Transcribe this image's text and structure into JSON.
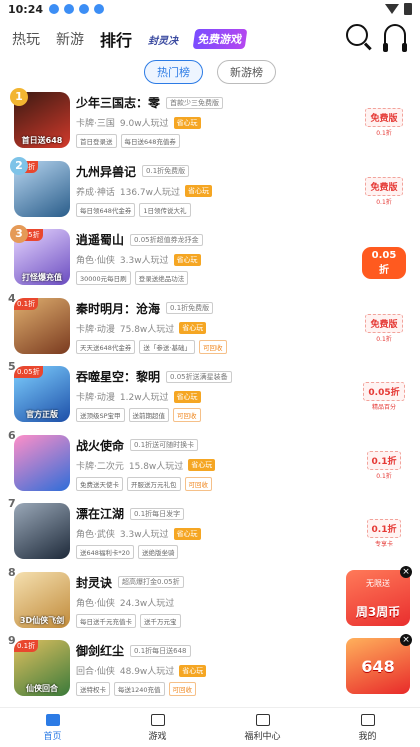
{
  "status": {
    "time": "10:24"
  },
  "header": {
    "tabs": [
      {
        "label": "热玩",
        "active": false
      },
      {
        "label": "新游",
        "active": false
      },
      {
        "label": "排行",
        "active": true
      }
    ],
    "logo1": "封灵决",
    "logo2": "免费游戏"
  },
  "subtabs": [
    {
      "label": "热门榜",
      "active": true
    },
    {
      "label": "新游榜",
      "active": false
    }
  ],
  "games": [
    {
      "rank": "1",
      "name": "少年三国志：零",
      "promo": "首款少三免费版",
      "meta1": "卡牌·三国",
      "players": "9.0w人玩过",
      "hot": "省心玩",
      "chips": [
        "首日登录送",
        "每日送648充值券"
      ],
      "icon_tag": "",
      "icon_caption": "首日送648",
      "badge": "免费版",
      "badge_sub": "0.1折",
      "badge_style": "outline",
      "colors": [
        "#d33a2c",
        "#3a1a12"
      ]
    },
    {
      "rank": "2",
      "name": "九州异兽记",
      "promo": "0.1折免费版",
      "meta1": "养成·神话",
      "players": "136.7w人玩过",
      "hot": "省心玩",
      "chips": [
        "每日领648代金券",
        "1日领传说大礼"
      ],
      "icon_tag": "0.1折",
      "icon_caption": "",
      "badge": "免费版",
      "badge_sub": "0.1折",
      "badge_style": "outline",
      "colors": [
        "#2a5d8a",
        "#b8d6f0"
      ]
    },
    {
      "rank": "3",
      "name": "逍遥蜀山",
      "promo": "0.05折超值券龙抒金",
      "meta1": "角色·仙侠",
      "players": "3.3w人玩过",
      "hot": "省心玩",
      "chips": [
        "30000元每日刷",
        "登录送绝品功法"
      ],
      "icon_tag": "0.05折",
      "icon_caption": "打怪爆充值",
      "badge": "0.05折",
      "badge_sub": "",
      "badge_style": "solid",
      "colors": [
        "#6a4cc0",
        "#e7d6ff"
      ]
    },
    {
      "rank": "4",
      "name": "秦时明月：沧海",
      "promo": "0.1折免费版",
      "meta1": "卡牌·动漫",
      "players": "75.8w人玩过",
      "hot": "省心玩",
      "chips": [
        "天天送648代金券",
        "送「参送·基础」",
        "可回收"
      ],
      "icon_tag": "0.1折",
      "icon_caption": "",
      "badge": "免费版",
      "badge_sub": "0.1折",
      "badge_style": "outline",
      "colors": [
        "#7a3a1f",
        "#e0b070"
      ]
    },
    {
      "rank": "5",
      "name": "吞噬星空：黎明",
      "promo": "0.05折送满星装备",
      "meta1": "卡牌·动漫",
      "players": "1.2w人玩过",
      "hot": "省心玩",
      "chips": [
        "送顶级SP宝甲",
        "送前期超值",
        "可回收"
      ],
      "icon_tag": "0.05折",
      "icon_caption": "官方正版",
      "badge": "0.05折",
      "badge_sub": "精品百分",
      "badge_style": "outline",
      "colors": [
        "#1d4fa8",
        "#7fd0ff"
      ]
    },
    {
      "rank": "6",
      "name": "战火使命",
      "promo": "0.1折送可随时换卡",
      "meta1": "卡牌·二次元",
      "players": "15.8w人玩过",
      "hot": "省心玩",
      "chips": [
        "免费送天使卡",
        "开服送万元礼包",
        "可回收"
      ],
      "icon_tag": "",
      "icon_caption": "",
      "badge": "0.1折",
      "badge_sub": "0.1折",
      "badge_style": "outline",
      "colors": [
        "#2f6dd8",
        "#ff8fc8"
      ]
    },
    {
      "rank": "7",
      "name": "漂在江湖",
      "promo": "0.1折每日发字",
      "meta1": "角色·武侠",
      "players": "3.3w人玩过",
      "hot": "省心玩",
      "chips": [
        "送648福利卡*20",
        "送绝版坐骑"
      ],
      "icon_tag": "",
      "icon_caption": "",
      "badge": "0.1折",
      "badge_sub": "专享卡",
      "badge_style": "outline",
      "colors": [
        "#1e2a3a",
        "#9aa8b8"
      ]
    },
    {
      "rank": "8",
      "name": "封灵诀",
      "promo": "超高爆打金0.05折",
      "meta1": "角色·仙侠",
      "players": "24.3w人玩过",
      "hot": "",
      "chips": [
        "每日送千元充值卡",
        "送千万元宝"
      ],
      "icon_tag": "",
      "icon_caption": "3D仙侠飞剑",
      "badge": "",
      "badge_sub": "",
      "badge_style": "none",
      "colors": [
        "#c08a3a",
        "#f5e0b0"
      ]
    },
    {
      "rank": "9",
      "name": "御剑红尘",
      "promo": "0.1折每日送648",
      "meta1": "回合·仙侠",
      "players": "48.9w人玩过",
      "hot": "省心玩",
      "chips": [
        "送特权卡",
        "每送1240充值",
        "可回收"
      ],
      "icon_tag": "0.1折",
      "icon_caption": "仙侠回合",
      "badge": "",
      "badge_sub": "",
      "badge_style": "none",
      "colors": [
        "#3a7a3a",
        "#e0c060"
      ]
    }
  ],
  "float_ads": [
    {
      "line1": "无限送",
      "line2": "周3周币"
    },
    {
      "line1": "",
      "line2": "648"
    }
  ],
  "bottom_nav": [
    {
      "label": "首页",
      "active": true
    },
    {
      "label": "游戏",
      "active": false
    },
    {
      "label": "福利中心",
      "active": false
    },
    {
      "label": "我的",
      "active": false
    }
  ],
  "accent": "#2c7be5",
  "medal_colors": [
    "#f2b531",
    "#7ec3e8",
    "#e59a57"
  ]
}
